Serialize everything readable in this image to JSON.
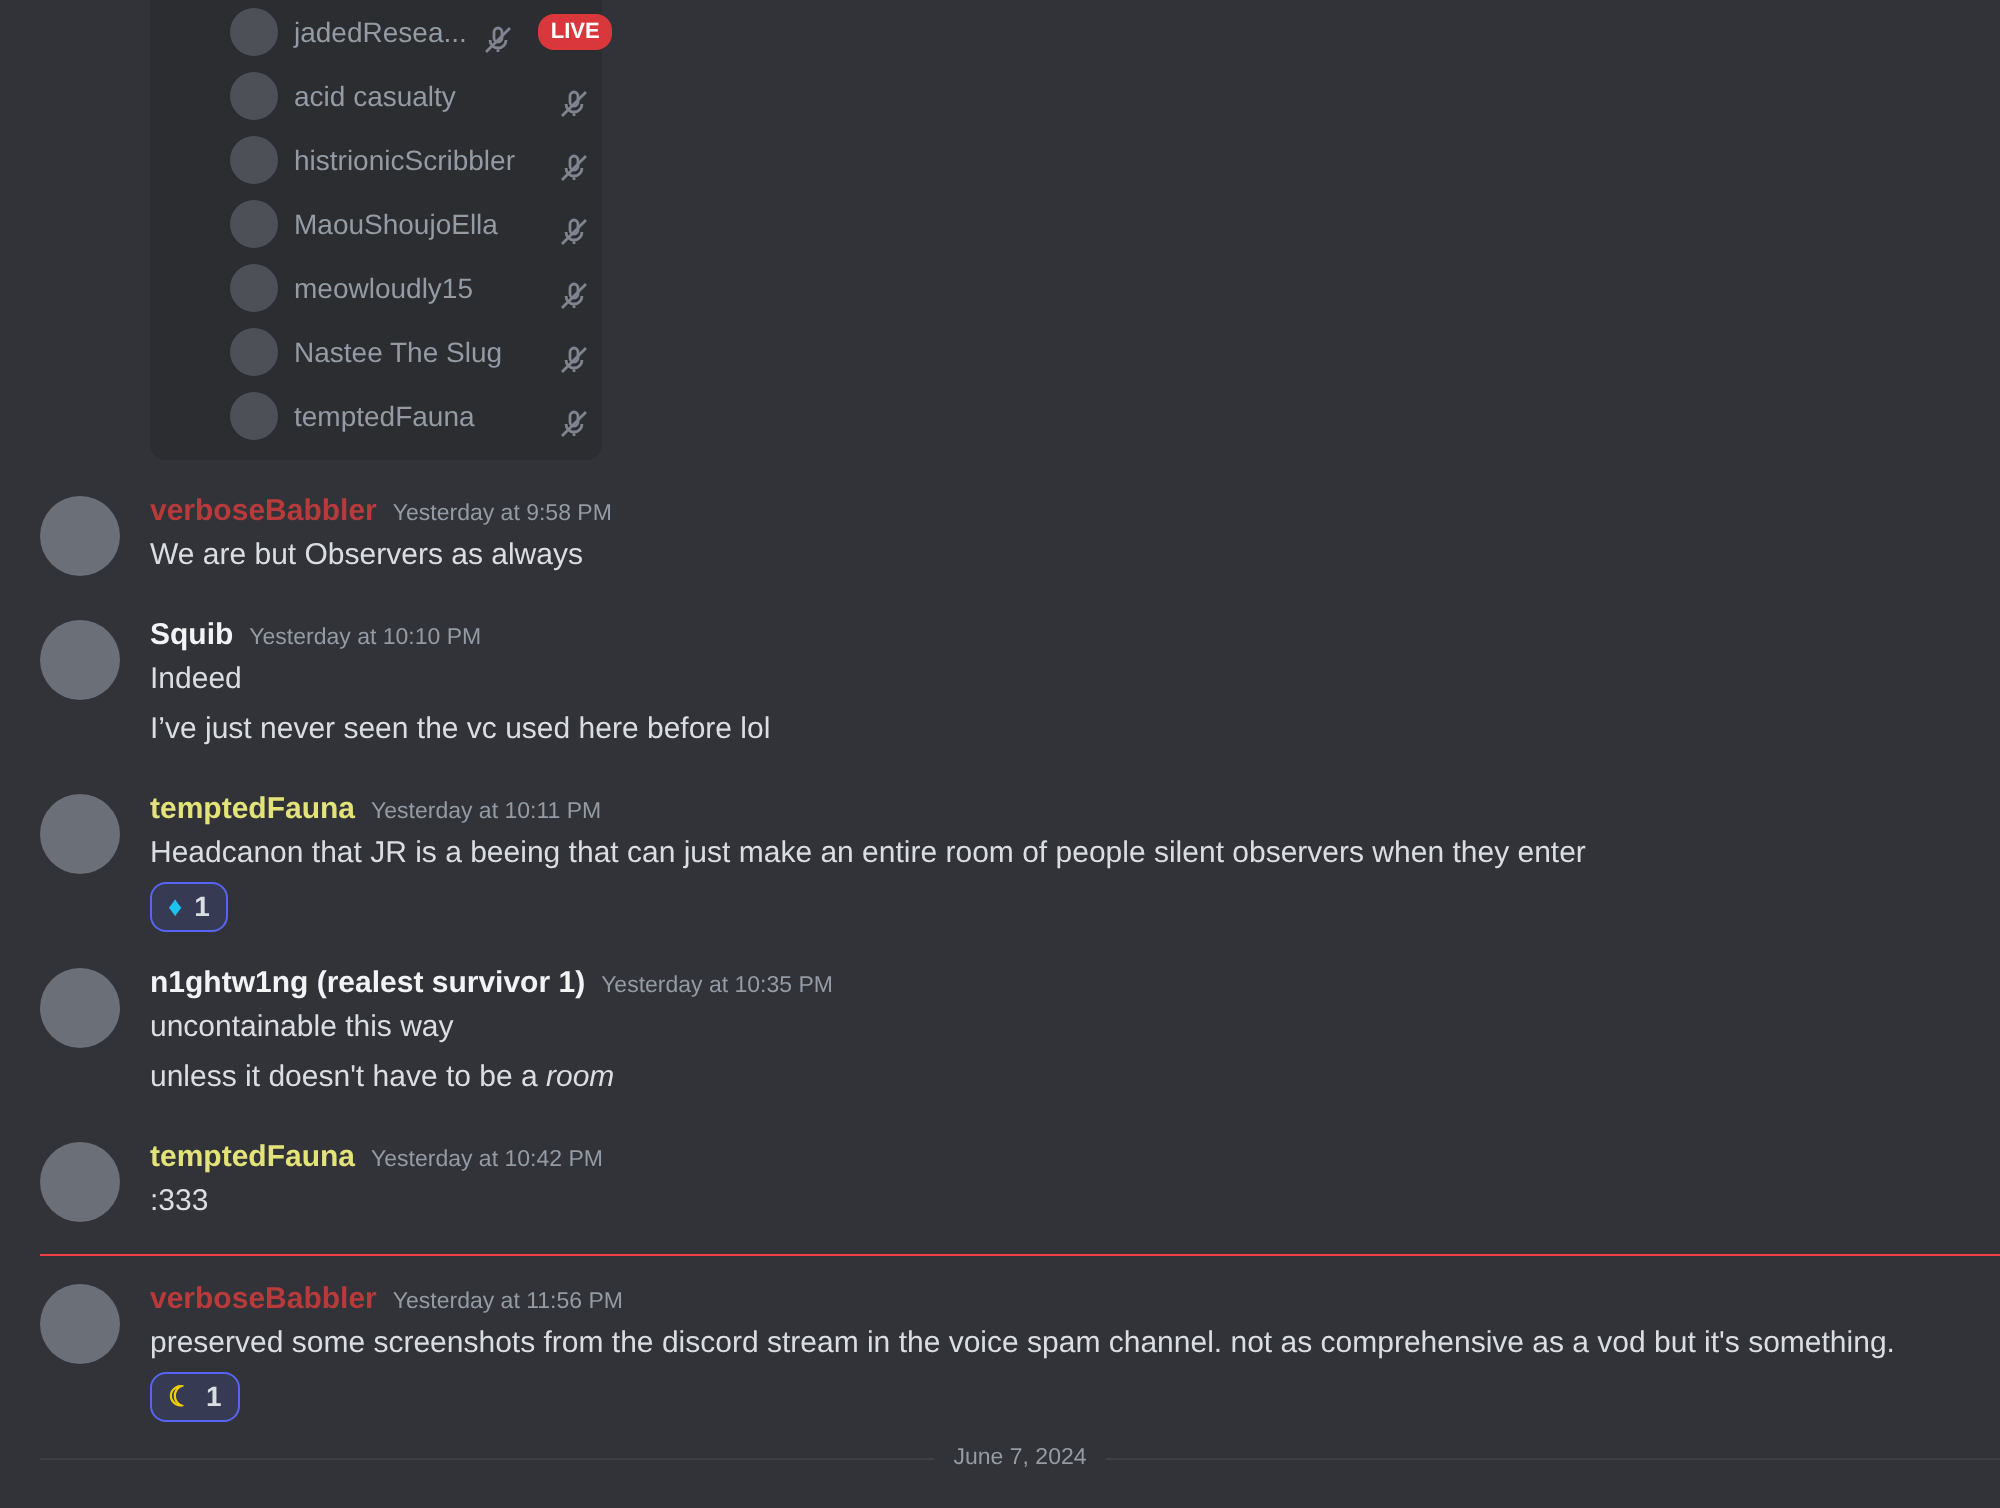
{
  "voice_channel": {
    "members": [
      {
        "name": "jadedResea...",
        "muted": true,
        "badge": "LIVE"
      },
      {
        "name": "acid casualty",
        "muted": true
      },
      {
        "name": "histrionicScribbler",
        "muted": true
      },
      {
        "name": "MaouShoujoElla",
        "muted": true
      },
      {
        "name": "meowloudly15",
        "muted": true
      },
      {
        "name": "Nastee The Slug",
        "muted": true
      },
      {
        "name": "temptedFauna",
        "muted": true
      }
    ]
  },
  "messages": [
    {
      "author": "verboseBabbler",
      "color": "#b83a3a",
      "time": "Yesterday at 9:58 PM",
      "lines": [
        "We are but Observers as always"
      ]
    },
    {
      "author": "Squib",
      "color": "#f2f3f5",
      "time": "Yesterday at 10:10 PM",
      "lines": [
        "Indeed",
        "I’ve just never seen the vc used here before lol"
      ]
    },
    {
      "author": "temptedFauna",
      "color": "#e3e37a",
      "time": "Yesterday at 10:11 PM",
      "lines": [
        "Headcanon that JR is a beeing that can just make an entire room of people silent observers when they enter"
      ],
      "reaction": {
        "emoji": "♦",
        "color": "#1dc3f0",
        "count": "1",
        "selected": true
      }
    },
    {
      "author": "n1ghtw1ng (realest survivor 1)",
      "color": "#f2f3f5",
      "time": "Yesterday at 10:35 PM",
      "lines": [
        "uncontainable this way",
        "unless it doesn't have to be a *room*"
      ]
    },
    {
      "author": "temptedFauna",
      "color": "#e3e37a",
      "time": "Yesterday at 10:42 PM",
      "lines": [
        ":333"
      ]
    },
    {
      "author": "verboseBabbler",
      "color": "#b83a3a",
      "time": "Yesterday at 11:56 PM",
      "lines": [
        "preserved some screenshots from the discord stream in the voice spam channel. not as comprehensive as a vod but it's something."
      ],
      "unread_before": true,
      "reaction": {
        "emoji": "☾",
        "color": "#f0d000",
        "count": "1",
        "selected": true
      }
    }
  ],
  "date_divider": "June 7, 2024"
}
